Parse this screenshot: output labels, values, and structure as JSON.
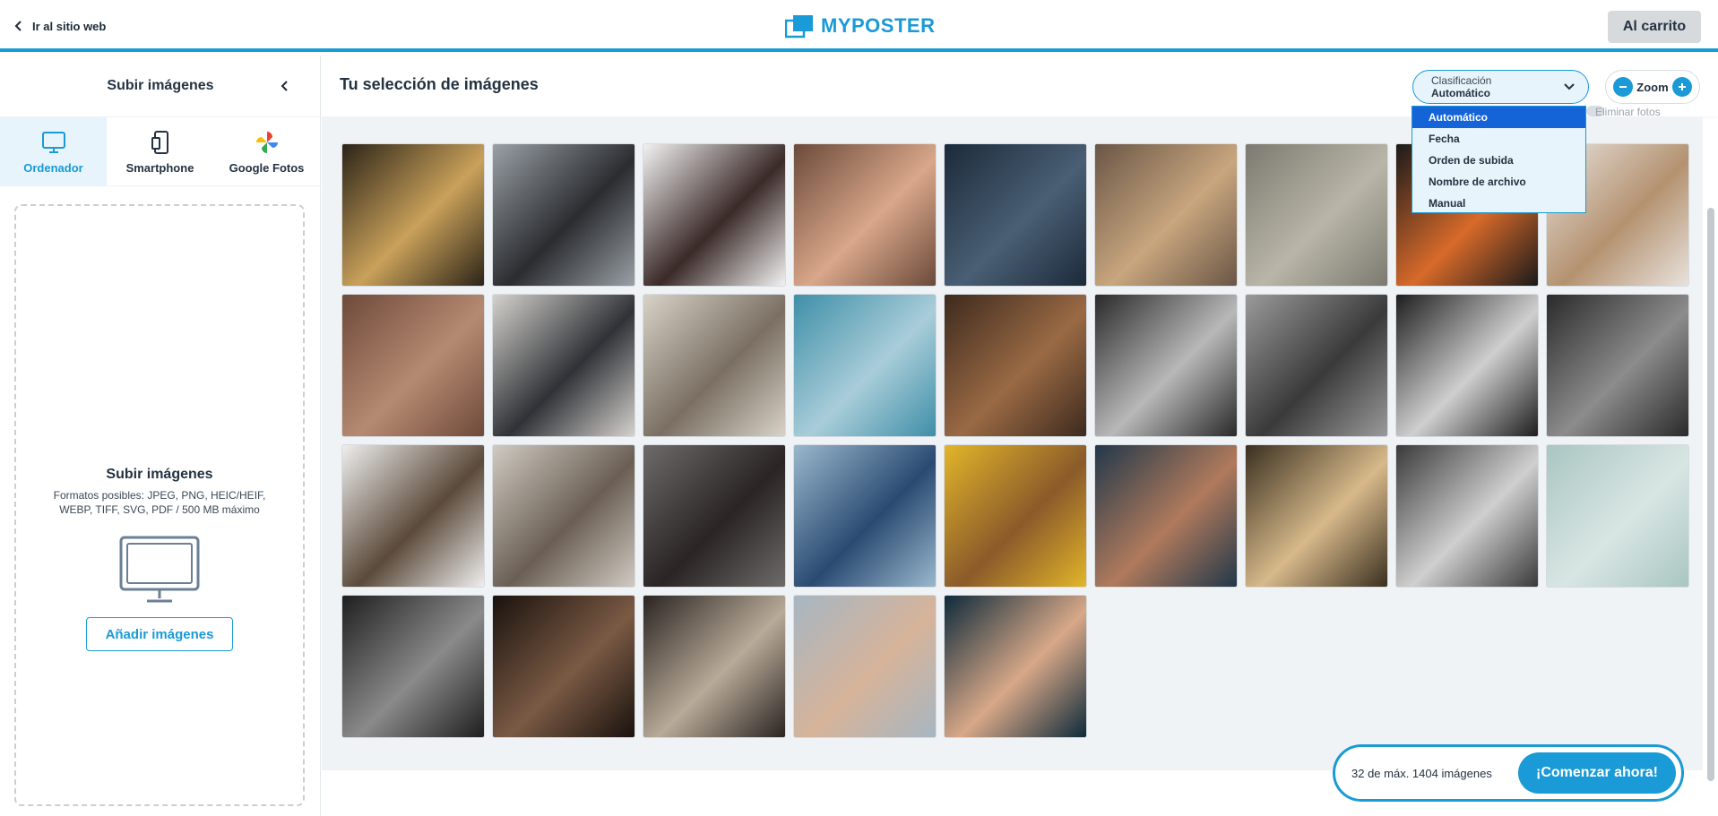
{
  "header": {
    "back_label": "Ir al sitio web",
    "logo_text": "MYPOSTER",
    "cart_label": "Al carrito",
    "accent": "#1a9ad6"
  },
  "sidebar": {
    "title": "Subir imágenes",
    "tabs": [
      {
        "label": "Ordenador",
        "icon": "monitor-icon",
        "active": true
      },
      {
        "label": "Smartphone",
        "icon": "smartphone-icon",
        "active": false
      },
      {
        "label": "Google Fotos",
        "icon": "google-photos-icon",
        "active": false
      }
    ],
    "dropzone": {
      "title": "Subir imágenes",
      "formats": "Formatos posibles: JPEG, PNG, HEIC/HEIF, WEBP, TIFF, SVG, PDF / 500 MB máximo",
      "add_label": "Añadir imágenes"
    }
  },
  "main": {
    "title": "Tu selección de imágenes",
    "sort": {
      "caption": "Clasificación",
      "value": "Automático",
      "options": [
        "Automático",
        "Fecha",
        "Orden de subida",
        "Nombre de archivo",
        "Manual"
      ],
      "selected_index": 0
    },
    "zoom_label": "Zoom",
    "delete_hint": "Eliminar fotos"
  },
  "gallery": {
    "images": [
      {
        "name": "bokeh-lights",
        "c1": "#2c2418",
        "c2": "#c9a15a"
      },
      {
        "name": "vintage-cameras",
        "c1": "#9aa0a6",
        "c2": "#2a2c30"
      },
      {
        "name": "polaroid-photos",
        "c1": "#f2f2f2",
        "c2": "#3a2a28"
      },
      {
        "name": "frosted-window",
        "c1": "#6b4a3a",
        "c2": "#d9a78a"
      },
      {
        "name": "dark-water",
        "c1": "#1c2a3a",
        "c2": "#4a5f74"
      },
      {
        "name": "rock-texture",
        "c1": "#6a5646",
        "c2": "#c8a67e"
      },
      {
        "name": "frost-grass",
        "c1": "#7c7a70",
        "c2": "#b9b5a8"
      },
      {
        "name": "orange-building",
        "c1": "#1a1a1a",
        "c2": "#d86a2a"
      },
      {
        "name": "dried-flowers-vase",
        "c1": "#e8e2dc",
        "c2": "#b49270"
      },
      {
        "name": "closed-eye",
        "c1": "#6e4a3a",
        "c2": "#b68a72"
      },
      {
        "name": "sneakers",
        "c1": "#d5d2cd",
        "c2": "#2f3237"
      },
      {
        "name": "open-book",
        "c1": "#d8d2c8",
        "c2": "#7a6f62"
      },
      {
        "name": "moon",
        "c1": "#3f8fa8",
        "c2": "#a9cdd9"
      },
      {
        "name": "autumn-hills",
        "c1": "#3d2a1e",
        "c2": "#9a6a44"
      },
      {
        "name": "group-children-bw",
        "c1": "#2a2a2a",
        "c2": "#b8b8b8"
      },
      {
        "name": "coast-bw",
        "c1": "#9a9a9a",
        "c2": "#3a3a3a"
      },
      {
        "name": "wave-bw",
        "c1": "#1e1e1e",
        "c2": "#cfcfcf"
      },
      {
        "name": "woman-flower-bw",
        "c1": "#2a2a2a",
        "c2": "#8c8c8c"
      },
      {
        "name": "palm-tree",
        "c1": "#eeeeee",
        "c2": "#5b4a3a"
      },
      {
        "name": "couple-stairs",
        "c1": "#cfcac2",
        "c2": "#6b5f54"
      },
      {
        "name": "woman-floor",
        "c1": "#6d6b69",
        "c2": "#2a2424"
      },
      {
        "name": "blue-curtain-sofa",
        "c1": "#9ab8cc",
        "c2": "#2a4a72"
      },
      {
        "name": "yellow-turban",
        "c1": "#e2b52a",
        "c2": "#8a5a2a"
      },
      {
        "name": "man-face-water",
        "c1": "#22384a",
        "c2": "#b07a5c"
      },
      {
        "name": "bokeh-lights-2",
        "c1": "#3a3020",
        "c2": "#d7b98a"
      },
      {
        "name": "woman-bus-bw",
        "c1": "#3a3a3a",
        "c2": "#cfcfcf"
      },
      {
        "name": "swimmers-aerial",
        "c1": "#a9c6c2",
        "c2": "#d8e6e3"
      },
      {
        "name": "hand-motorcycle",
        "c1": "#1f1f1f",
        "c2": "#8a8a8a"
      },
      {
        "name": "hands-flower",
        "c1": "#1a120e",
        "c2": "#7a5a44"
      },
      {
        "name": "newspaper-hand",
        "c1": "#2a2422",
        "c2": "#b8aa98"
      },
      {
        "name": "blurred-hand",
        "c1": "#a7b6c2",
        "c2": "#d6b49a"
      },
      {
        "name": "hand-in-water",
        "c1": "#0e2a3a",
        "c2": "#d8a888"
      }
    ]
  },
  "cta": {
    "count_text": "32 de máx. 1404 imágenes",
    "start_label": "¡Comenzar ahora!"
  }
}
